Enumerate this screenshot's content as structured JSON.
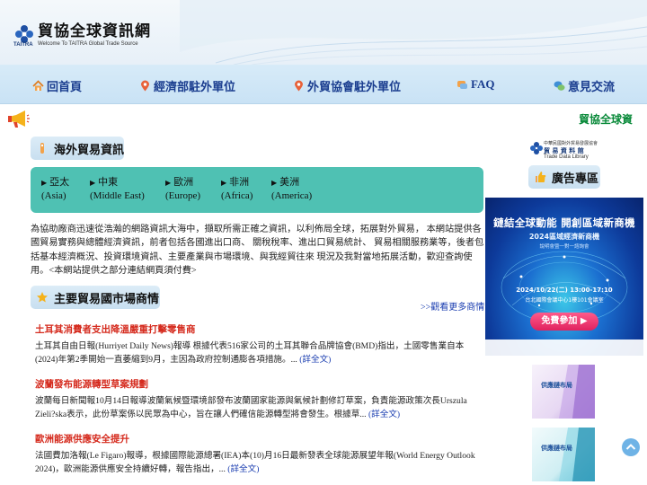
{
  "header": {
    "logo_title": "貿協全球資訊網",
    "logo_subtitle": "Welcome To TAITRA Global Trade Source",
    "logo_brand": "TAITRA"
  },
  "nav": {
    "items": [
      {
        "label": "回首頁",
        "icon": "home-icon"
      },
      {
        "label": "經濟部駐外單位",
        "icon": "location-pin-icon"
      },
      {
        "label": "外貿協會駐外單位",
        "icon": "location-pin-icon"
      },
      {
        "label": "FAQ",
        "icon": "faq-icon"
      },
      {
        "label": "意見交流",
        "icon": "chat-bubbles-icon"
      }
    ]
  },
  "marquee": {
    "text": "貿協全球資"
  },
  "sections": {
    "overseas_title": "海外貿易資訊",
    "markets_title": "主要貿易國市場商情",
    "ad_title": "廣告專區"
  },
  "regions": [
    {
      "zh": "亞太",
      "en": "(Asia)"
    },
    {
      "zh": "中東",
      "en": "(Middle East)"
    },
    {
      "zh": "歐洲",
      "en": "(Europe)"
    },
    {
      "zh": "非洲",
      "en": "(Africa)"
    },
    {
      "zh": "美洲",
      "en": "(America)"
    }
  ],
  "intro": "為協助廠商迅速從浩瀚的網路資訊大海中，擷取所需正確之資訊，以利佈局全球，拓展對外貿易， 本網站提供各國貿易實務與總體經濟資訊，前者包括各國進出口商、 關稅稅率、進出口貿易統計、 貿易相關服務業等，後者包括基本經濟概況、投資環境資訊、主要產業與市場環境、與我經貿往來 現況及我對當地拓展活動，歡迎查詢使用。<本網站提供之部分連結網頁須付費>",
  "more_link": ">>觀看更多商情",
  "news": [
    {
      "title": "土耳其消費者支出降溫嚴重打擊零售商",
      "body": "土耳其自由日報(Hurriyet Daily News)報導 根據代表516家公司的土耳其聯合品牌協會(BMD)指出，土國零售業自本(2024)年第2季開始一直萎縮到9月，主因為政府控制通膨各項措施。... ",
      "link": "(詳全文)"
    },
    {
      "title": "波蘭發布能源轉型草案規劃",
      "body": "波蘭每日新聞報10月14日報導波蘭氣候暨環境部發布波蘭國家能源與氣候計劃修訂草案，負責能源政策次長Urszula Zieli?ska表示，此份草案係以民眾為中心，旨在讓人們確信能源轉型將會發生。根據草... ",
      "link": "(詳全文)"
    },
    {
      "title": "歐洲能源供應安全提升",
      "body": "法國費加洛報(Le Figaro)報導，根據國際能源總署(IEA)本(10)月16日最新發表全球能源展望年報(World Energy Outlook 2024)，歐洲能源供應安全持續好轉，報告指出，... ",
      "link": "(詳全文)"
    }
  ],
  "trade_data_library": {
    "line1": "中華民國對外貿易發展協會",
    "line2": "貿 易 資 料 館",
    "line3": "Trade Data Library",
    "brand": "TAITRA"
  },
  "banner": {
    "title": "鏈結全球動能 開創區域新商機",
    "subtitle": "2024區域經濟新商機",
    "subtitle2": "說明會暨一對一諮詢會",
    "date": "2024/10/22(二) 13:00-17:10",
    "venue": "台北國際會議中心1樓101會議室",
    "button": "免費參加 ▶"
  },
  "books": [
    {
      "label": "供應鏈布局"
    },
    {
      "label": "供應鏈布局"
    }
  ],
  "colors": {
    "nav_text": "#1a3d8f",
    "news_title": "#d52b1e",
    "link": "#1a3db0",
    "region_box": "#4fc1b3",
    "marquee": "#0a8a3a"
  }
}
